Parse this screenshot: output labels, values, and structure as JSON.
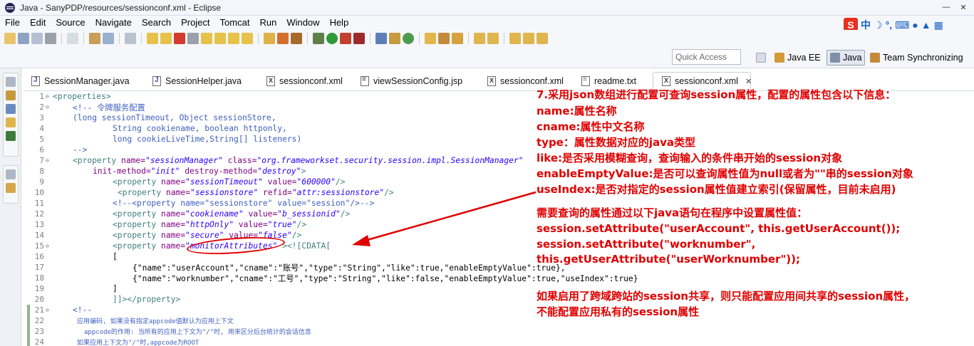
{
  "window": {
    "title": "Java - SanyPDP/resources/sessionconf.xml - Eclipse",
    "minimize_icon": "minimize-icon",
    "close_icon": "close-icon"
  },
  "menu": [
    "File",
    "Edit",
    "Source",
    "Navigate",
    "Search",
    "Project",
    "Tomcat",
    "Run",
    "Window",
    "Help"
  ],
  "ime": {
    "logo": "S",
    "lang": "中",
    "icons": [
      "moon-icon",
      "dot-icon",
      "keyboard-icon",
      "user-icon",
      "shirt-icon",
      "grid-icon"
    ]
  },
  "perspectives": {
    "quick_access_placeholder": "Quick Access",
    "items": [
      {
        "label": "Java EE",
        "active": false
      },
      {
        "label": "Java",
        "active": true
      },
      {
        "label": "Team Synchronizing",
        "active": false
      }
    ]
  },
  "tabs": [
    {
      "label": "SessionManager.java",
      "type": "java",
      "active": false
    },
    {
      "label": "SessionHelper.java",
      "type": "java",
      "active": false
    },
    {
      "label": "sessionconf.xml",
      "type": "xml",
      "active": false
    },
    {
      "label": "viewSessionConfig.jsp",
      "type": "jsp",
      "active": false
    },
    {
      "label": "sessionconf.xml",
      "type": "xml",
      "active": false
    },
    {
      "label": "readme.txt",
      "type": "txt",
      "active": false
    },
    {
      "label": "sessionconf.xml",
      "type": "xml",
      "active": true
    }
  ],
  "code": {
    "l1": {
      "n": "1",
      "t": "<properties>"
    },
    "l2": {
      "n": "2",
      "t": "<!-- 令牌服务配置"
    },
    "l3": {
      "n": "3",
      "t": "(long sessionTimeout, Object sessionStore,"
    },
    "l4": {
      "n": "4",
      "t": "String cookiename, boolean httponly,"
    },
    "l5": {
      "n": "5",
      "t": "long cookieLiveTime,String[] listeners)"
    },
    "l6": {
      "n": "6",
      "t": "-->"
    },
    "l7": {
      "n": "7",
      "a": "<property ",
      "b": "name=",
      "c": "\"sessionManager\"",
      "d": " class=",
      "e": "\"org.frameworkset.security.session.impl.SessionManager\""
    },
    "l8": {
      "n": "8",
      "a": "init-method=",
      "b": "\"init\"",
      "c": " destroy-method=",
      "d": "\"destroy\"",
      "e": ">"
    },
    "l9": {
      "n": "9",
      "a": "<property ",
      "b": "name=",
      "c": "\"sessionTimeout\"",
      "d": " value=",
      "e": "\"600000\"",
      "f": "/>"
    },
    "l10": {
      "n": "10",
      "a": "<property ",
      "b": "name=",
      "c": "\"sessionstore\"",
      "d": " refid=",
      "e": "\"attr:sessionstore\"",
      "f": "/>"
    },
    "l11": {
      "n": "11",
      "t": "<!--<property name=\"sessionstore\" value=\"session\"/>-->"
    },
    "l12": {
      "n": "12",
      "a": "<property ",
      "b": "name=",
      "c": "\"cookiename\"",
      "d": " value=",
      "e": "\"b_sessionid\"",
      "f": "/>"
    },
    "l13": {
      "n": "13",
      "a": "<property ",
      "b": "name=",
      "c": "\"httpOnly\"",
      "d": " value=",
      "e": "\"true\"",
      "f": "/>"
    },
    "l14": {
      "n": "14",
      "a": "<property ",
      "b": "name=",
      "c": "\"secure\"",
      "d": " value=",
      "e": "\"false\"",
      "f": "/>"
    },
    "l15": {
      "n": "15",
      "a": "<property ",
      "b": "name=",
      "c": "\"monitorAttributes\"",
      "d": " ><![CDATA["
    },
    "l16": {
      "n": "16",
      "t": "["
    },
    "l17": {
      "n": "17",
      "t": "{\"name\":\"userAccount\",\"cname\":\"账号\",\"type\":\"String\",\"like\":true,\"enableEmptyValue\":true},"
    },
    "l18": {
      "n": "18",
      "t": "{\"name\":\"worknumber\",\"cname\":\"工号\",\"type\":\"String\",\"like\":false,\"enableEmptyValue\":true,\"useIndex\":true}"
    },
    "l19": {
      "n": "19",
      "t": "]"
    },
    "l20": {
      "n": "20",
      "t": "]]></property>"
    },
    "l21": {
      "n": "21",
      "t": "<!--"
    },
    "l22": {
      "n": "22",
      "t": "应用编码, 如果没有指定appcode值默认为应用上下文"
    },
    "l23": {
      "n": "23",
      "t": "appcode的作用: 当所有的应用上下文为\"/\"时, 用来区分后台统计的会话信息"
    },
    "l24": {
      "n": "24",
      "t": "如果应用上下文为\"/\"时,appcode为ROOT"
    }
  },
  "annotation": {
    "line1": "7.采用json数组进行配置可查询session属性，配置的属性包含以下信息：",
    "line2": "name:属性名称",
    "line3": "cname:属性中文名称",
    "line4": "type：属性数据对应的java类型",
    "line5": "like:是否采用模糊查询，查询输入的条件串开始的session对象",
    "line6": "enableEmptyValue:是否可以查询属性值为null或者为\"\"串的session对象",
    "line7": "useIndex:是否对指定的session属性值建立索引(保留属性，目前未启用)",
    "line8": "需要查询的属性通过以下java语句在程序中设置属性值：",
    "line9": "session.setAttribute(\"userAccount\", this.getUserAccount());",
    "line10": "  session.setAttribute(\"worknumber\",",
    "line11": "this.getUserAttribute(\"userWorknumber\"));",
    "line12": "如果启用了跨域跨站的session共享，则只能配置应用间共享的session属性，",
    "line13": "不能配置应用私有的session属性"
  },
  "colors": {
    "accent_red": "#e00000",
    "xml_tag": "#3f7f7f",
    "xml_attr": "#7f007f",
    "xml_string": "#2a00ff",
    "xml_comment": "#3f5fbf"
  }
}
